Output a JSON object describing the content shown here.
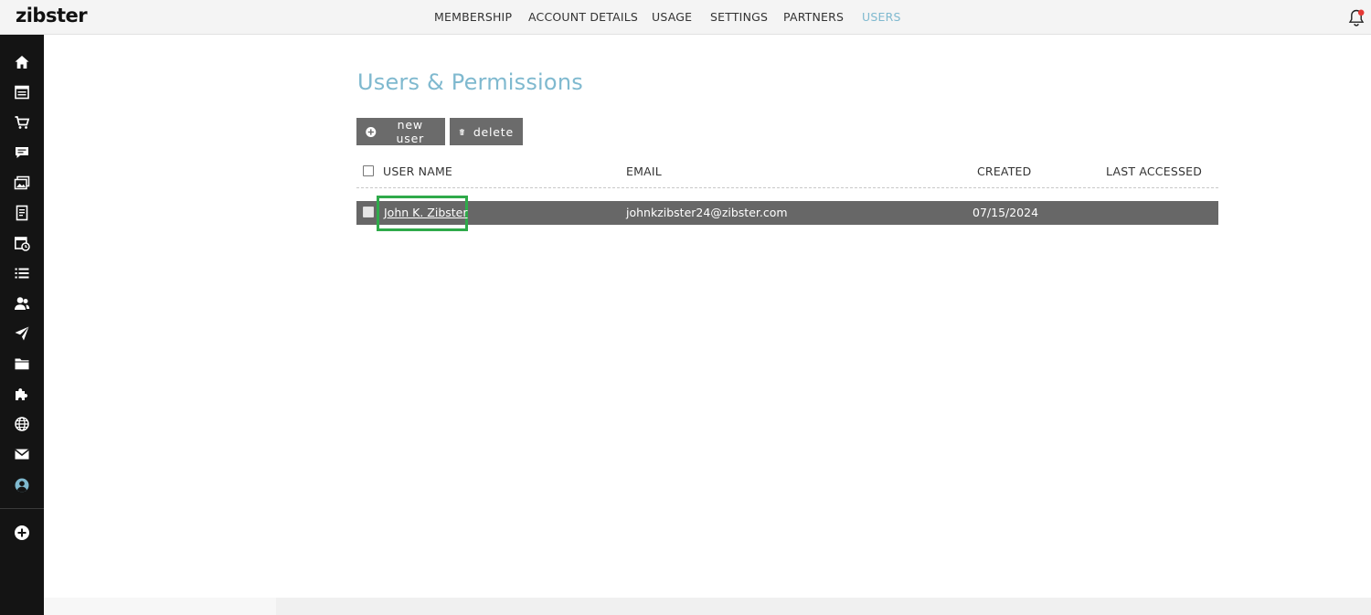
{
  "app": {
    "logo": "zibster"
  },
  "topnav": {
    "items": [
      {
        "label": "MEMBERSHIP",
        "active": false
      },
      {
        "label": "ACCOUNT DETAILS",
        "active": false
      },
      {
        "label": "USAGE",
        "active": false
      },
      {
        "label": "SETTINGS",
        "active": false
      },
      {
        "label": "PARTNERS",
        "active": false
      },
      {
        "label": "USERS",
        "active": true
      }
    ],
    "notification_icon": "bell-icon",
    "notification_badge_color": "#e53935"
  },
  "sidebar": {
    "icons": [
      "home-icon",
      "calendar-list-icon",
      "cart-icon",
      "chat-icon",
      "images-icon",
      "document-icon",
      "event-calendar-icon",
      "list-icon",
      "users-icon",
      "send-icon",
      "folder-icon",
      "puzzle-icon",
      "globe-icon",
      "mail-icon",
      "account-icon",
      "add-icon"
    ],
    "active_icon": "account-icon",
    "active_color": "#7fb9cf"
  },
  "main": {
    "title": "Users & Permissions",
    "buttons": {
      "new_user": "new user",
      "delete": "delete"
    },
    "table": {
      "columns": [
        "USER NAME",
        "EMAIL",
        "CREATED",
        "LAST ACCESSED"
      ],
      "rows": [
        {
          "name": "John K. Zibster",
          "email": "johnkzibster24@zibster.com",
          "created": "07/15/2024",
          "last_accessed": ""
        }
      ]
    }
  },
  "colors": {
    "accent": "#7fb9cf",
    "row_bg": "#676767",
    "button_bg": "#6b6b6b",
    "highlight": "#2faa4a"
  }
}
